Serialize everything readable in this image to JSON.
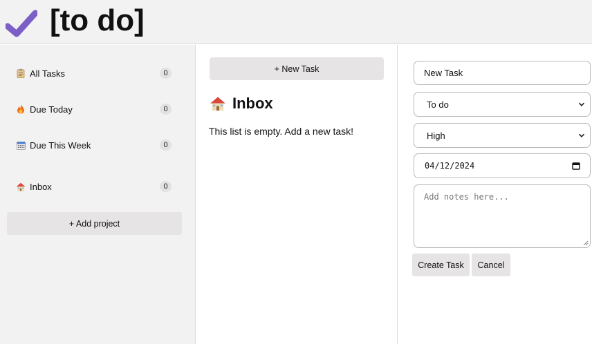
{
  "app": {
    "title": "[to do]"
  },
  "sidebar": {
    "items": [
      {
        "label": "All Tasks",
        "count": "0",
        "icon": "clipboard-icon"
      },
      {
        "label": "Due Today",
        "count": "0",
        "icon": "fire-icon"
      },
      {
        "label": "Due This Week",
        "count": "0",
        "icon": "calendar-icon"
      },
      {
        "label": "Inbox",
        "count": "0",
        "icon": "house-icon"
      }
    ],
    "add_project_label": "+ Add project"
  },
  "main": {
    "new_task_label": "+ New Task",
    "list_title": "Inbox",
    "empty_message": "This list is empty. Add a new task!"
  },
  "form": {
    "task_name": "New Task",
    "status": {
      "selected": "To do"
    },
    "priority": {
      "selected": "High"
    },
    "due_date": "04/12/2024",
    "notes_placeholder": "Add notes here...",
    "create_label": "Create Task",
    "cancel_label": "Cancel"
  },
  "colors": {
    "accent_check": "#7b5fc7",
    "panel_bg": "#f2f2f2",
    "button_bg": "#e6e4e5"
  }
}
